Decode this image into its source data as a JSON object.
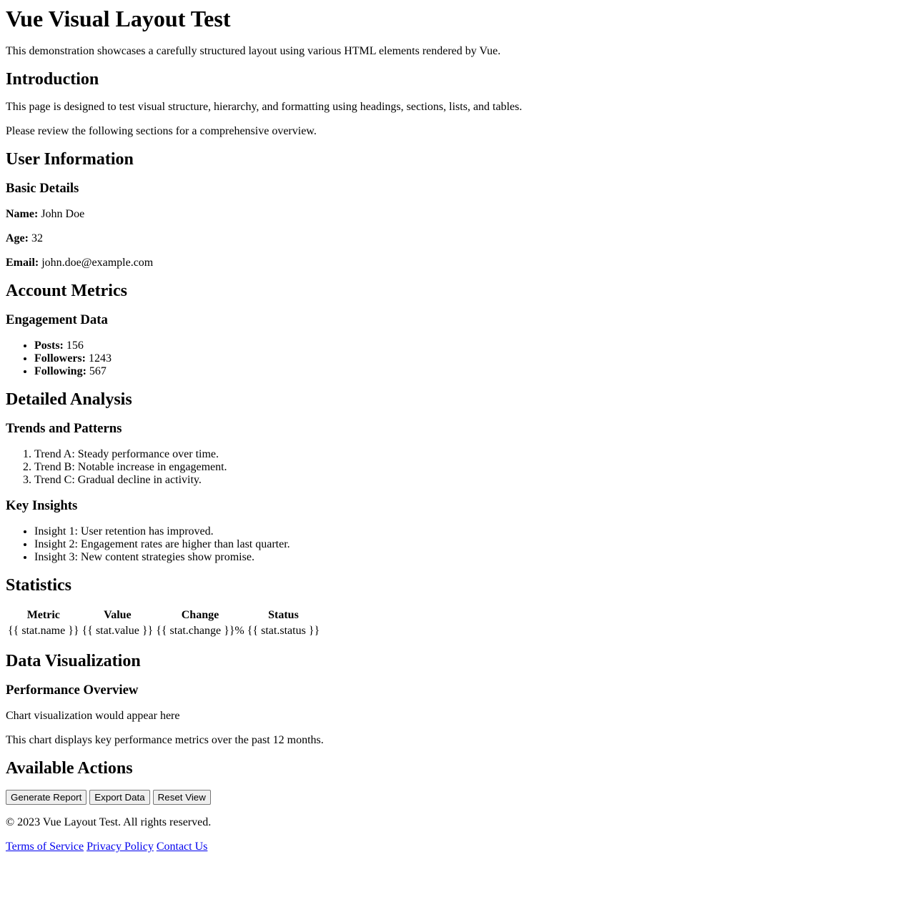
{
  "header": {
    "title": "Vue Visual Layout Test",
    "subtitle": "This demonstration showcases a carefully structured layout using various HTML elements rendered by Vue."
  },
  "introduction": {
    "heading": "Introduction",
    "paragraphs": [
      "This page is designed to test visual structure, hierarchy, and formatting using headings, sections, lists, and tables.",
      "Please review the following sections for a comprehensive overview."
    ]
  },
  "user_info": {
    "heading": "User Information",
    "subheading": "Basic Details",
    "fields": [
      {
        "label": "Name:",
        "value": "John Doe"
      },
      {
        "label": "Age:",
        "value": "32"
      },
      {
        "label": "Email:",
        "value": "john.doe@example.com"
      }
    ]
  },
  "account_metrics": {
    "heading": "Account Metrics",
    "subheading": "Engagement Data",
    "items": [
      {
        "label": "Posts:",
        "value": "156"
      },
      {
        "label": "Followers:",
        "value": "1243"
      },
      {
        "label": "Following:",
        "value": "567"
      }
    ]
  },
  "detailed_analysis": {
    "heading": "Detailed Analysis",
    "trends_heading": "Trends and Patterns",
    "trends": [
      "Trend A: Steady performance over time.",
      "Trend B: Notable increase in engagement.",
      "Trend C: Gradual decline in activity."
    ],
    "insights_heading": "Key Insights",
    "insights": [
      "Insight 1: User retention has improved.",
      "Insight 2: Engagement rates are higher than last quarter.",
      "Insight 3: New content strategies show promise."
    ]
  },
  "statistics": {
    "heading": "Statistics",
    "columns": [
      "Metric",
      "Value",
      "Change",
      "Status"
    ],
    "rows": [
      [
        "{{ stat.name }}",
        "{{ stat.value }}",
        "{{ stat.change }}%",
        "{{ stat.status }}"
      ]
    ]
  },
  "data_visualization": {
    "heading": "Data Visualization",
    "subheading": "Performance Overview",
    "placeholder": "Chart visualization would appear here",
    "caption": "This chart displays key performance metrics over the past 12 months."
  },
  "actions": {
    "heading": "Available Actions",
    "buttons": [
      "Generate Report",
      "Export Data",
      "Reset View"
    ]
  },
  "footer": {
    "copyright": "© 2023 Vue Layout Test. All rights reserved.",
    "links": [
      "Terms of Service",
      "Privacy Policy",
      "Contact Us"
    ]
  }
}
